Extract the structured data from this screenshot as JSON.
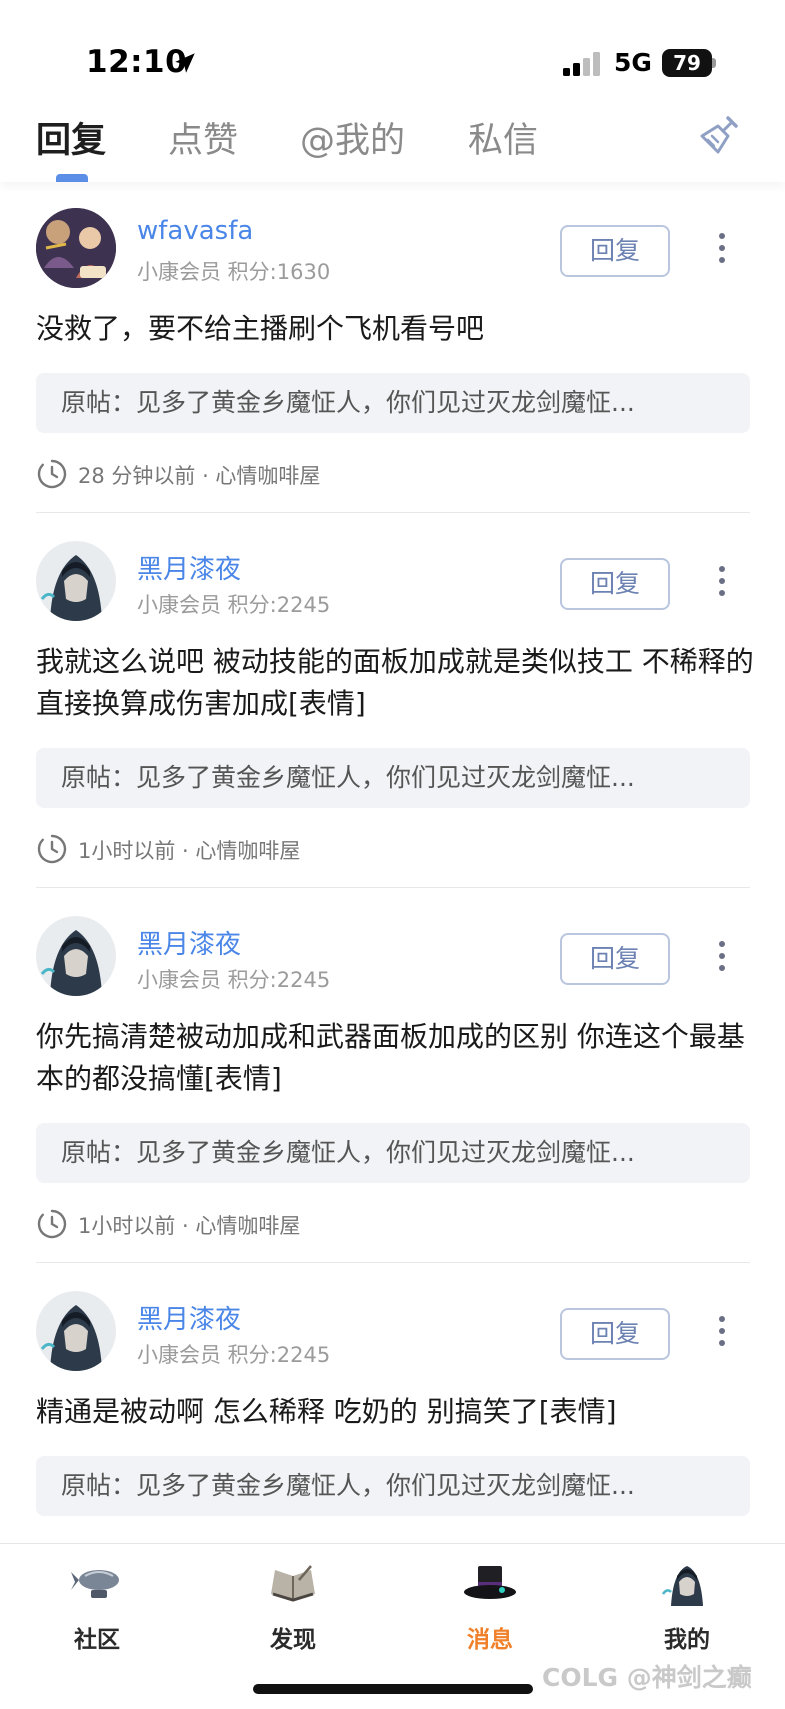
{
  "status_bar": {
    "time": "12:10",
    "network": "5G",
    "battery": "79"
  },
  "tabs": [
    {
      "label": "回复",
      "active": true
    },
    {
      "label": "点赞",
      "active": false
    },
    {
      "label": "@我的",
      "active": false
    },
    {
      "label": "私信",
      "active": false
    }
  ],
  "reply_label": "回复",
  "messages": [
    {
      "username": "wfavasfa",
      "meta": "小康会员 积分:1630",
      "content": "没救了，要不给主播刷个飞机看号吧",
      "quote": "原帖：见多了黄金乡魔怔人，你们见过灭龙剑魔怔...",
      "time": "28 分钟以前 · 心情咖啡屋"
    },
    {
      "username": "黑月漆夜",
      "meta": "小康会员 积分:2245",
      "content": "我就这么说吧 被动技能的面板加成就是类似技工 不稀释的 直接换算成伤害加成[表情]",
      "quote": "原帖：见多了黄金乡魔怔人，你们见过灭龙剑魔怔...",
      "time": "1小时以前 · 心情咖啡屋"
    },
    {
      "username": "黑月漆夜",
      "meta": "小康会员 积分:2245",
      "content": "你先搞清楚被动加成和武器面板加成的区别  你连这个最基本的都没搞懂[表情]",
      "quote": "原帖：见多了黄金乡魔怔人，你们见过灭龙剑魔怔...",
      "time": "1小时以前 · 心情咖啡屋"
    },
    {
      "username": "黑月漆夜",
      "meta": "小康会员 积分:2245",
      "content": "精通是被动啊 怎么稀释 吃奶的 别搞笑了[表情]",
      "quote": "原帖：见多了黄金乡魔怔人，你们见过灭龙剑魔怔..."
    }
  ],
  "bottom_nav": [
    {
      "label": "社区",
      "active": false
    },
    {
      "label": "发现",
      "active": false
    },
    {
      "label": "消息",
      "active": true
    },
    {
      "label": "我的",
      "active": false
    }
  ],
  "watermark": "COLG @神剑之癫",
  "colors": {
    "accent": "#4a86e8",
    "active_nav": "#f0802a",
    "indicator": "#5b8ee6"
  }
}
